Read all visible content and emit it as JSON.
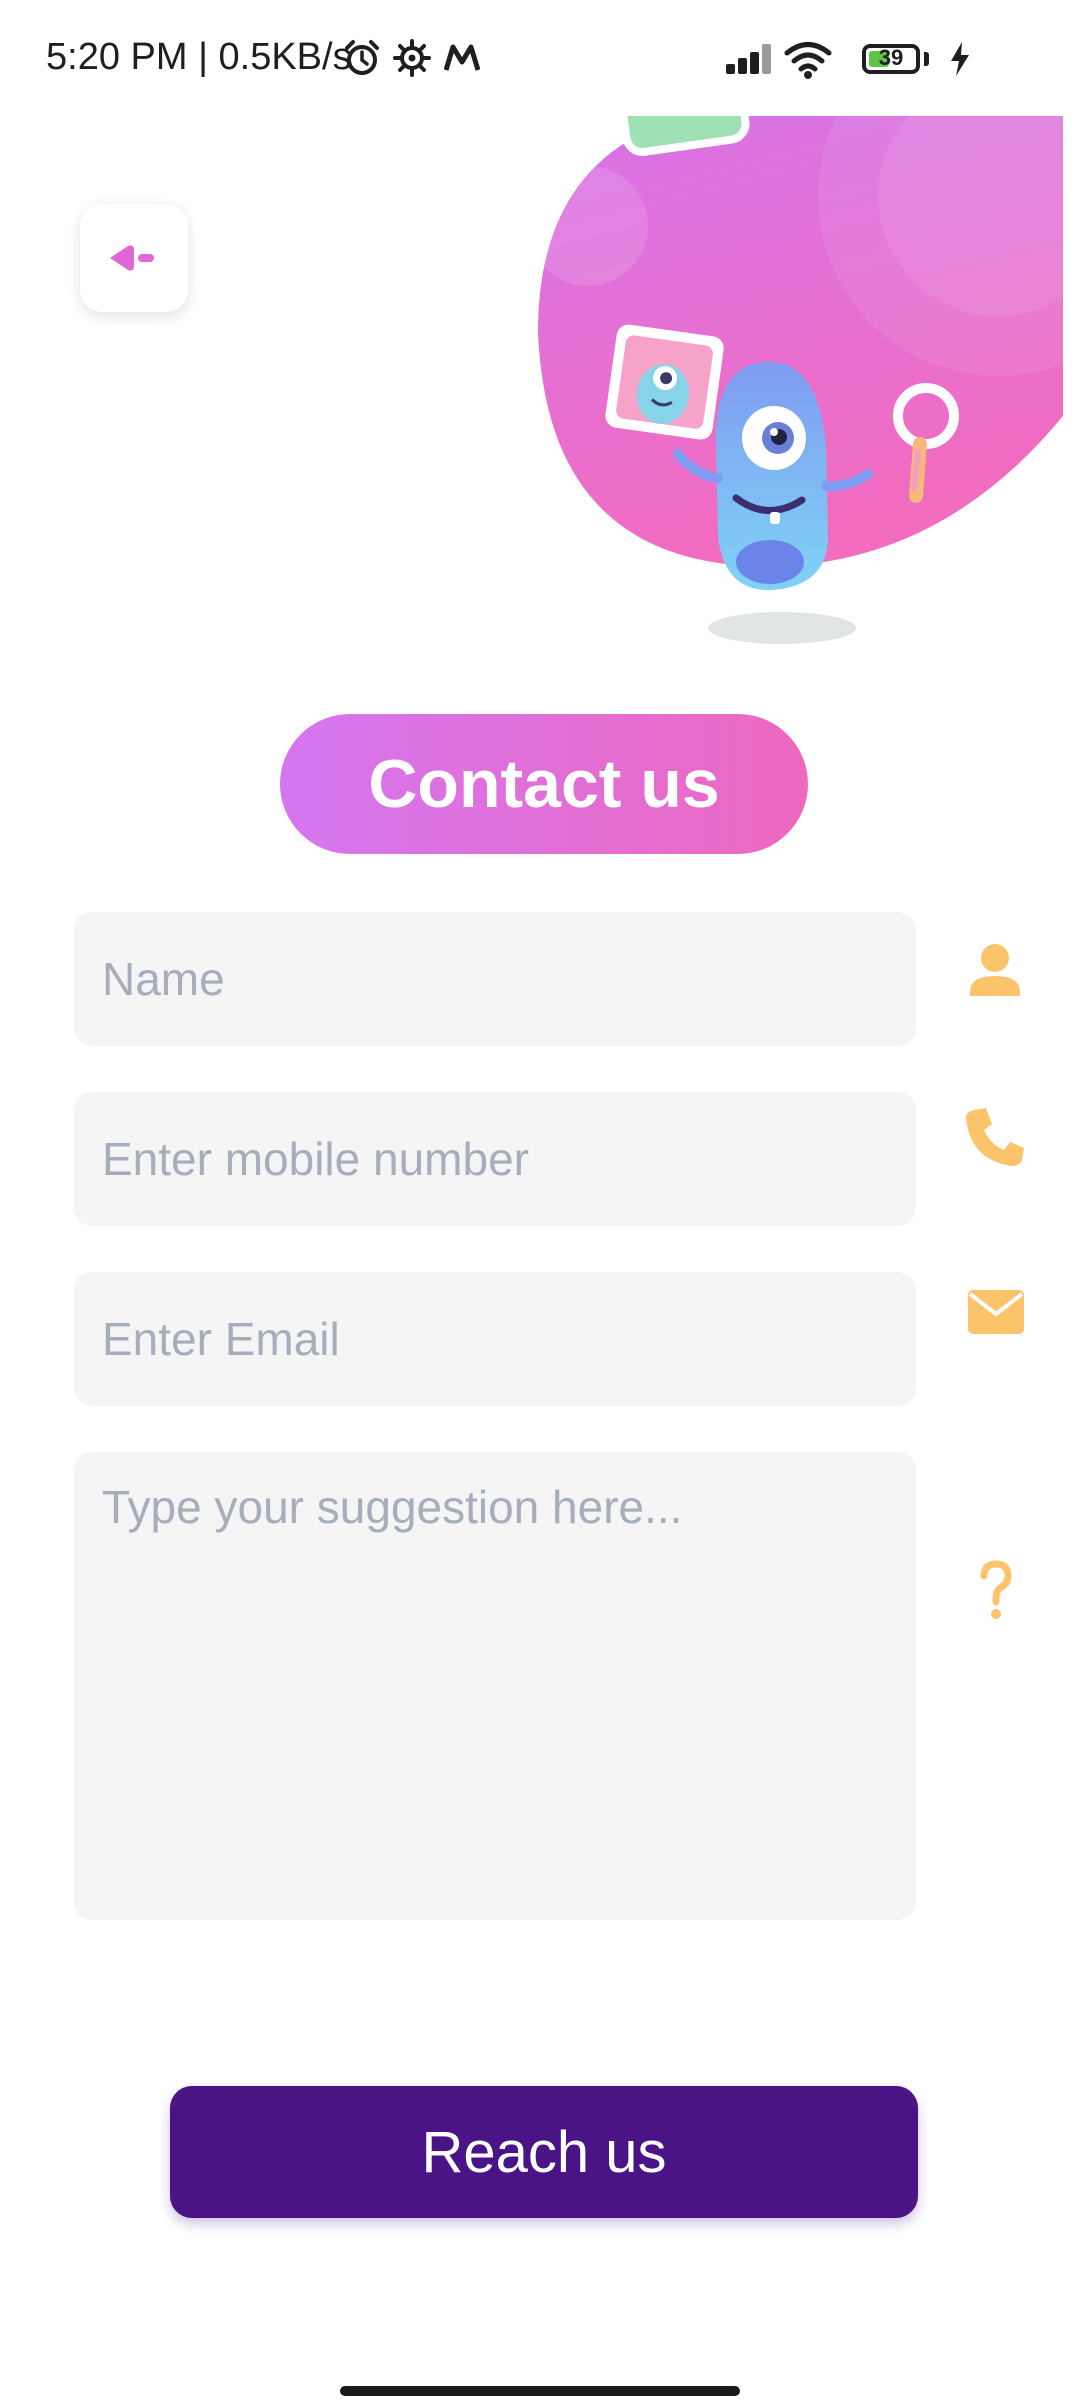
{
  "status_bar": {
    "time_speed": "5:20 PM | 0.5KB/s",
    "battery_level": "39",
    "icons": [
      "alarm-icon",
      "settings-gear-icon",
      "m-app-icon",
      "signal-icon",
      "wifi-icon",
      "battery-icon",
      "charging-icon"
    ]
  },
  "header": {
    "back_icon": "back-arrow-icon"
  },
  "page": {
    "title": "Contact us"
  },
  "form": {
    "name_placeholder": "Name",
    "mobile_placeholder": "Enter mobile number",
    "email_placeholder": "Enter Email",
    "suggestion_placeholder": "Type your suggestion here...",
    "icons": [
      "person-icon",
      "phone-icon",
      "mail-icon",
      "question-icon"
    ],
    "submit_label": "Reach us"
  },
  "colors": {
    "accent_pink": "#e065d6",
    "icon_orange": "#fbc46a",
    "submit_purple": "#4a1487",
    "field_bg": "#f5f5f5"
  }
}
